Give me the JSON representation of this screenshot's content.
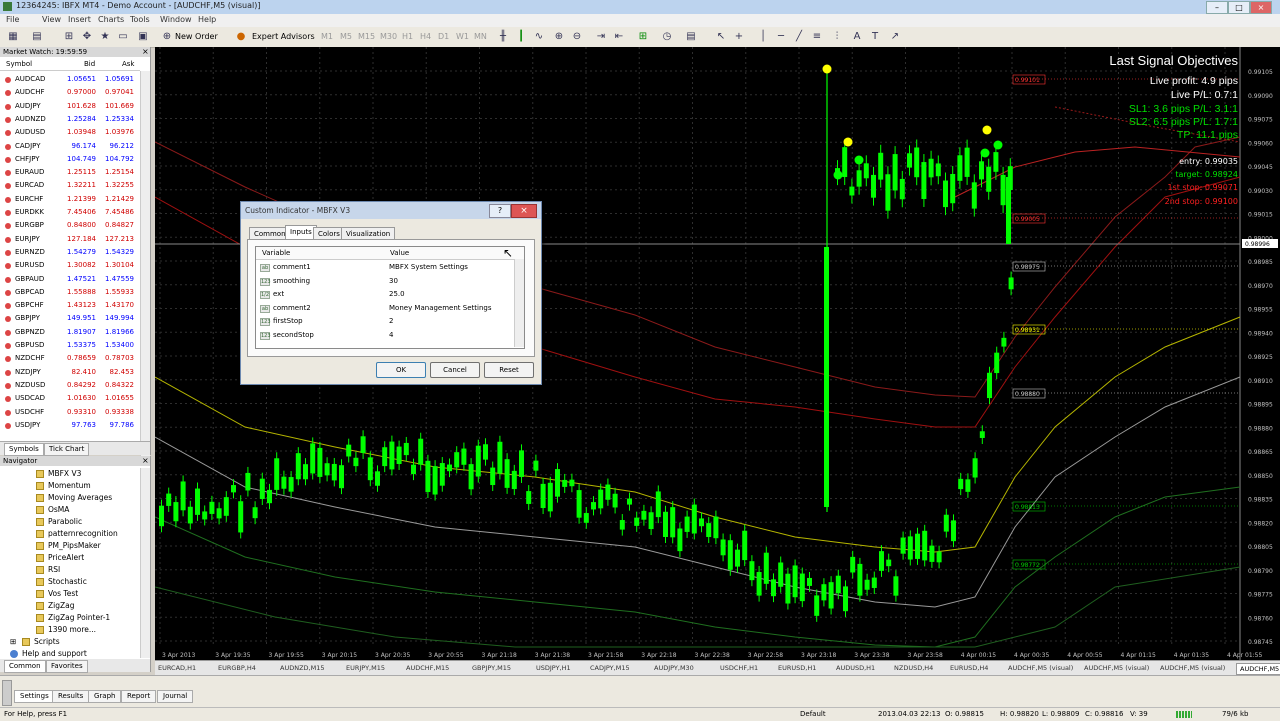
{
  "window": {
    "title": "12364245: IBFX MT4 - Demo Account - [AUDCHF,M5 (visual)]"
  },
  "menu": [
    "File",
    "View",
    "Insert",
    "Charts",
    "Tools",
    "Window",
    "Help"
  ],
  "toolbar": {
    "new_order": "New Order",
    "expert_advisors": "Expert Advisors",
    "timeframes": [
      "M1",
      "M5",
      "M15",
      "M30",
      "H1",
      "H4",
      "D1",
      "W1",
      "MN"
    ]
  },
  "market_watch": {
    "header": "Market Watch: 19:59:59",
    "col_symbol": "Symbol",
    "col_bid": "Bid",
    "col_ask": "Ask",
    "rows": [
      {
        "s": "AUDCAD",
        "b": "1.05651",
        "a": "1.05691",
        "d": "up"
      },
      {
        "s": "AUDCHF",
        "b": "0.97000",
        "a": "0.97041",
        "d": "dn"
      },
      {
        "s": "AUDJPY",
        "b": "101.628",
        "a": "101.669",
        "d": "dn"
      },
      {
        "s": "AUDNZD",
        "b": "1.25284",
        "a": "1.25334",
        "d": "up"
      },
      {
        "s": "AUDUSD",
        "b": "1.03948",
        "a": "1.03976",
        "d": "dn"
      },
      {
        "s": "CADJPY",
        "b": "96.174",
        "a": "96.212",
        "d": "up"
      },
      {
        "s": "CHFJPY",
        "b": "104.749",
        "a": "104.792",
        "d": "up"
      },
      {
        "s": "EURAUD",
        "b": "1.25115",
        "a": "1.25154",
        "d": "dn"
      },
      {
        "s": "EURCAD",
        "b": "1.32211",
        "a": "1.32255",
        "d": "dn"
      },
      {
        "s": "EURCHF",
        "b": "1.21399",
        "a": "1.21429",
        "d": "dn"
      },
      {
        "s": "EURDKK",
        "b": "7.45406",
        "a": "7.45486",
        "d": "dn"
      },
      {
        "s": "EURGBP",
        "b": "0.84800",
        "a": "0.84827",
        "d": "dn"
      },
      {
        "s": "EURJPY",
        "b": "127.184",
        "a": "127.213",
        "d": "dn"
      },
      {
        "s": "EURNZD",
        "b": "1.54279",
        "a": "1.54329",
        "d": "up"
      },
      {
        "s": "EURUSD",
        "b": "1.30082",
        "a": "1.30104",
        "d": "dn"
      },
      {
        "s": "GBPAUD",
        "b": "1.47521",
        "a": "1.47559",
        "d": "up"
      },
      {
        "s": "GBPCAD",
        "b": "1.55888",
        "a": "1.55933",
        "d": "dn"
      },
      {
        "s": "GBPCHF",
        "b": "1.43123",
        "a": "1.43170",
        "d": "dn"
      },
      {
        "s": "GBPJPY",
        "b": "149.951",
        "a": "149.994",
        "d": "up"
      },
      {
        "s": "GBPNZD",
        "b": "1.81907",
        "a": "1.81966",
        "d": "up"
      },
      {
        "s": "GBPUSD",
        "b": "1.53375",
        "a": "1.53400",
        "d": "up"
      },
      {
        "s": "NZDCHF",
        "b": "0.78659",
        "a": "0.78703",
        "d": "dn"
      },
      {
        "s": "NZDJPY",
        "b": "82.410",
        "a": "82.453",
        "d": "dn"
      },
      {
        "s": "NZDUSD",
        "b": "0.84292",
        "a": "0.84322",
        "d": "dn"
      },
      {
        "s": "USDCAD",
        "b": "1.01630",
        "a": "1.01655",
        "d": "dn"
      },
      {
        "s": "USDCHF",
        "b": "0.93310",
        "a": "0.93338",
        "d": "dn"
      },
      {
        "s": "USDJPY",
        "b": "97.763",
        "a": "97.786",
        "d": "up"
      }
    ],
    "tabs": [
      "Symbols",
      "Tick Chart"
    ]
  },
  "navigator": {
    "header": "Navigator",
    "items": [
      "MBFX V3",
      "Momentum",
      "Moving Averages",
      "OsMA",
      "Parabolic",
      "patternrecognition",
      "PM_PipsMaker",
      "PriceAlert",
      "RSI",
      "Stochastic",
      "Vos Test",
      "ZigZag",
      "ZigZag Pointer-1",
      "1390 more..."
    ],
    "scripts": "Scripts",
    "help": "Help and support",
    "tabs": [
      "Common",
      "Favorites"
    ]
  },
  "dialog": {
    "title": "Custom Indicator - MBFX V3",
    "help_btn": "?",
    "close_btn": "×",
    "tabs": [
      "Common",
      "Inputs",
      "Colors",
      "Visualization"
    ],
    "col_variable": "Variable",
    "col_value": "Value",
    "rows": [
      {
        "icon": "ab",
        "var": "comment1",
        "val": "MBFX System Settings"
      },
      {
        "icon": "123",
        "var": "smoothing",
        "val": "30"
      },
      {
        "icon": "1/2",
        "var": "ext",
        "val": "25.0"
      },
      {
        "icon": "ab",
        "var": "comment2",
        "val": "Money Management Settings"
      },
      {
        "icon": "123",
        "var": "firstStop",
        "val": "2"
      },
      {
        "icon": "123",
        "var": "secondStop",
        "val": "4"
      }
    ],
    "ok": "OK",
    "cancel": "Cancel",
    "reset": "Reset"
  },
  "signal": {
    "title": "Last Signal Objectives",
    "live_profit": "Live profit: 4.9 pips",
    "live_pl": "Live P/L: 0.7:1",
    "sl1": "SL1: 3.6 pips P/L: 3.1:1",
    "sl2": "SL2: 6.5 pips P/L: 1.7:1",
    "tp": "TP: 11.1 pips",
    "entry": "entry: 0.99035",
    "target": "target: 0.98924",
    "stop1": "1st stop: 0.99071",
    "stop2": "2nd stop: 0.99100"
  },
  "chart": {
    "price_ticks": [
      "0.99105",
      "0.99090",
      "0.99075",
      "0.99060",
      "0.99045",
      "0.99030",
      "0.99015",
      "0.99000",
      "0.98985",
      "0.98970",
      "0.98955",
      "0.98940",
      "0.98925",
      "0.98910",
      "0.98895",
      "0.98880",
      "0.98865",
      "0.98850",
      "0.98835",
      "0.98820",
      "0.98805",
      "0.98790",
      "0.98775",
      "0.98760",
      "0.98745"
    ],
    "time_ticks": [
      "3 Apr 2013",
      "3 Apr 19:35",
      "3 Apr 19:55",
      "3 Apr 20:15",
      "3 Apr 20:35",
      "3 Apr 20:55",
      "3 Apr 21:18",
      "3 Apr 21:38",
      "3 Apr 21:58",
      "3 Apr 22:18",
      "3 Apr 22:38",
      "3 Apr 22:58",
      "3 Apr 23:18",
      "3 Apr 23:38",
      "3 Apr 23:58",
      "4 Apr 00:15",
      "4 Apr 00:35",
      "4 Apr 00:55",
      "4 Apr 01:15",
      "4 Apr 01:35",
      "4 Apr 01:55"
    ],
    "price_labels": [
      {
        "text": "0.99101",
        "color": "#ff3333"
      },
      {
        "text": "0.99005",
        "color": "#ff3333"
      },
      {
        "text": "0.98975",
        "color": "#c0c0c0"
      },
      {
        "text": "0.98931",
        "color": "#ffff00"
      },
      {
        "text": "0.98880",
        "color": "#c0c0c0"
      },
      {
        "text": "0.98813",
        "color": "#00c000"
      },
      {
        "text": "0.98772",
        "color": "#00c000"
      }
    ],
    "current_price": "0.98996"
  },
  "chart_tabs": [
    "EURCAD,H1",
    "EURGBP,H4",
    "AUDNZD,M15",
    "EURJPY,M15",
    "AUDCHF,M15",
    "GBPJPY,M15",
    "USDJPY,H1",
    "CADJPY,M15",
    "AUDJPY,M30",
    "USDCHF,H1",
    "EURUSD,H1",
    "AUDUSD,H1",
    "NZDUSD,H4",
    "EURUSD,H4",
    "AUDCHF,M5 (visual)",
    "AUDCHF,M5 (visual)",
    "AUDCHF,M5 (visual)",
    "AUDCHF,M5 (visual)"
  ],
  "tester_tabs": [
    "Settings",
    "Results",
    "Graph",
    "Report",
    "Journal"
  ],
  "status": {
    "help": "For Help, press F1",
    "profile": "Default",
    "datetime": "2013.04.03 22:13",
    "open": "O: 0.98815",
    "high": "H: 0.98820",
    "low": "L: 0.98809",
    "close": "C: 0.98816",
    "volume": "V: 39",
    "traffic": "79/6 kb"
  },
  "colors": {
    "bull_candle": "#00ff00",
    "bear_candle": "#00ff00",
    "signal_dot": "#ffff00",
    "up_price": "#0000ff",
    "down_price": "#d00000"
  }
}
